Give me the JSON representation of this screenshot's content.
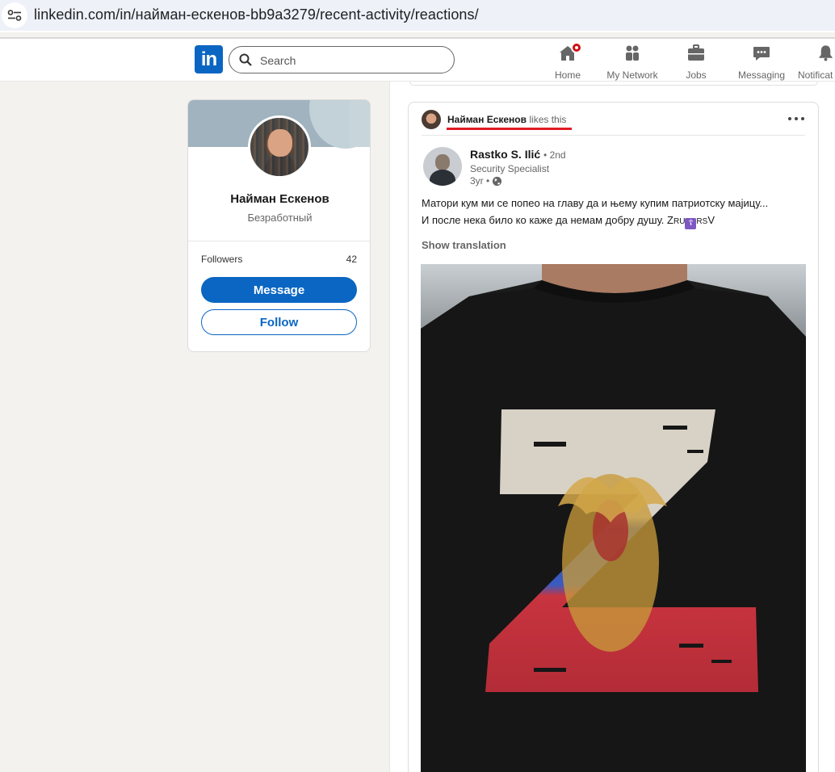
{
  "browser": {
    "url": "linkedin.com/in/найман-ескенов-bb9a3279/recent-activity/reactions/"
  },
  "nav": {
    "logo": "in",
    "search_placeholder": "Search",
    "items": [
      {
        "label": "Home",
        "icon": "home-icon"
      },
      {
        "label": "My Network",
        "icon": "network-icon"
      },
      {
        "label": "Jobs",
        "icon": "briefcase-icon"
      },
      {
        "label": "Messaging",
        "icon": "messaging-icon"
      },
      {
        "label": "Notificat",
        "icon": "bell-icon"
      }
    ],
    "brand_color": "#0a66c2",
    "badge_color": "#cc1016"
  },
  "profile": {
    "name": "Найман Ескенов",
    "headline": "Безработный",
    "followers_label": "Followers",
    "followers_count": "42",
    "message_label": "Message",
    "follow_label": "Follow"
  },
  "post": {
    "liker_name": "Найман Ескенов",
    "liker_action": "likes this",
    "author_name": "Rastko S. Ilić",
    "author_degree": "• 2nd",
    "author_headline": "Security Specialist",
    "age": "3yr •",
    "text_line1": "Матори кум ми се попео на главу да и њему купим патриотску мајицу...",
    "text_line2_a": "И после нека било ко каже да немам добру душу. Z",
    "text_line2_b": "RU",
    "text_line2_cross": "☦",
    "text_line2_c": "RS",
    "text_line2_d": "V",
    "show_translation": "Show translation",
    "highlight_color": "#e01b24"
  }
}
